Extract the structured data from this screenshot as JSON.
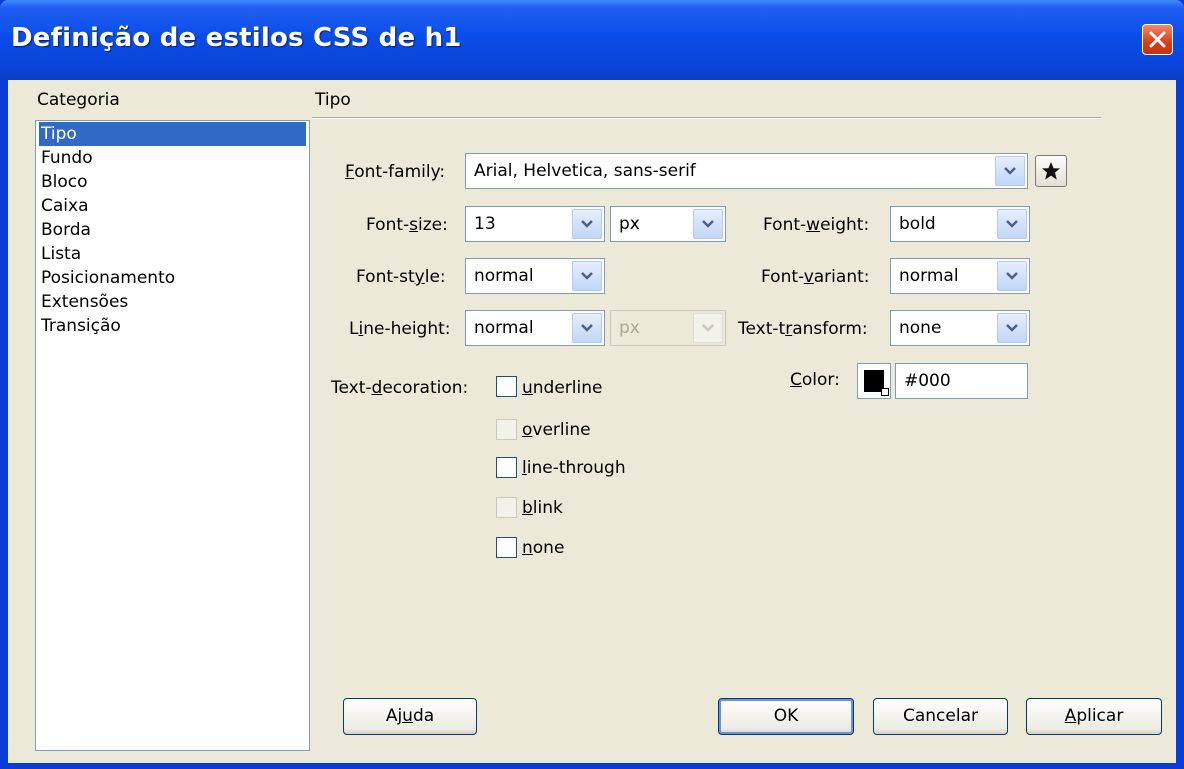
{
  "window": {
    "title": "Definição de estilos CSS de h1"
  },
  "category": {
    "heading": "Categoria",
    "items": [
      "Tipo",
      "Fundo",
      "Bloco",
      "Caixa",
      "Borda",
      "Lista",
      "Posicionamento",
      "Extensões",
      "Transição"
    ],
    "selected": "Tipo"
  },
  "panel": {
    "heading": "Tipo"
  },
  "fields": {
    "font_family": {
      "label_key": "F",
      "label_rest": "ont-family:",
      "value": "Arial, Helvetica, sans-serif"
    },
    "font_size": {
      "label_pre": "Font-",
      "label_key": "s",
      "label_rest": "ize:",
      "value": "13",
      "unit": "px"
    },
    "font_weight": {
      "label_pre": "Font-",
      "label_key": "w",
      "label_rest": "eight:",
      "value": "bold"
    },
    "font_style": {
      "label_pre": "Font-st",
      "label_key": "y",
      "label_rest": "le:",
      "value": "normal"
    },
    "font_variant": {
      "label_pre": "Font-",
      "label_key": "v",
      "label_rest": "ariant:",
      "value": "normal"
    },
    "line_height": {
      "label_pre": "L",
      "label_key": "i",
      "label_rest": "ne-height:",
      "value": "normal",
      "unit": "px"
    },
    "text_transform": {
      "label_pre": "Text-t",
      "label_key": "r",
      "label_rest": "ansform:",
      "value": "none"
    },
    "color": {
      "label_key": "C",
      "label_rest": "olor:",
      "value": "#000"
    }
  },
  "text_decoration": {
    "label_pre": "Text-",
    "label_key": "d",
    "label_rest": "ecoration:",
    "options": [
      {
        "key": "u",
        "rest": "nderline",
        "checked": false,
        "enabled": true
      },
      {
        "key": "o",
        "rest": "verline",
        "checked": false,
        "enabled": false
      },
      {
        "key": "l",
        "rest": "ine-through",
        "checked": false,
        "enabled": true
      },
      {
        "key": "b",
        "rest": "link",
        "checked": false,
        "enabled": false
      },
      {
        "key": "n",
        "rest": "one",
        "checked": false,
        "enabled": true
      }
    ]
  },
  "buttons": {
    "help": {
      "pre": "Aj",
      "key": "u",
      "rest": "da"
    },
    "ok": "OK",
    "cancel": "Cancelar",
    "apply": {
      "key": "A",
      "rest": "plicar"
    }
  },
  "colors": {
    "title_bar": "#0a4de8",
    "selection": "#316ac5",
    "dialog_bg": "#ece9d8",
    "close": "#d6401c"
  }
}
